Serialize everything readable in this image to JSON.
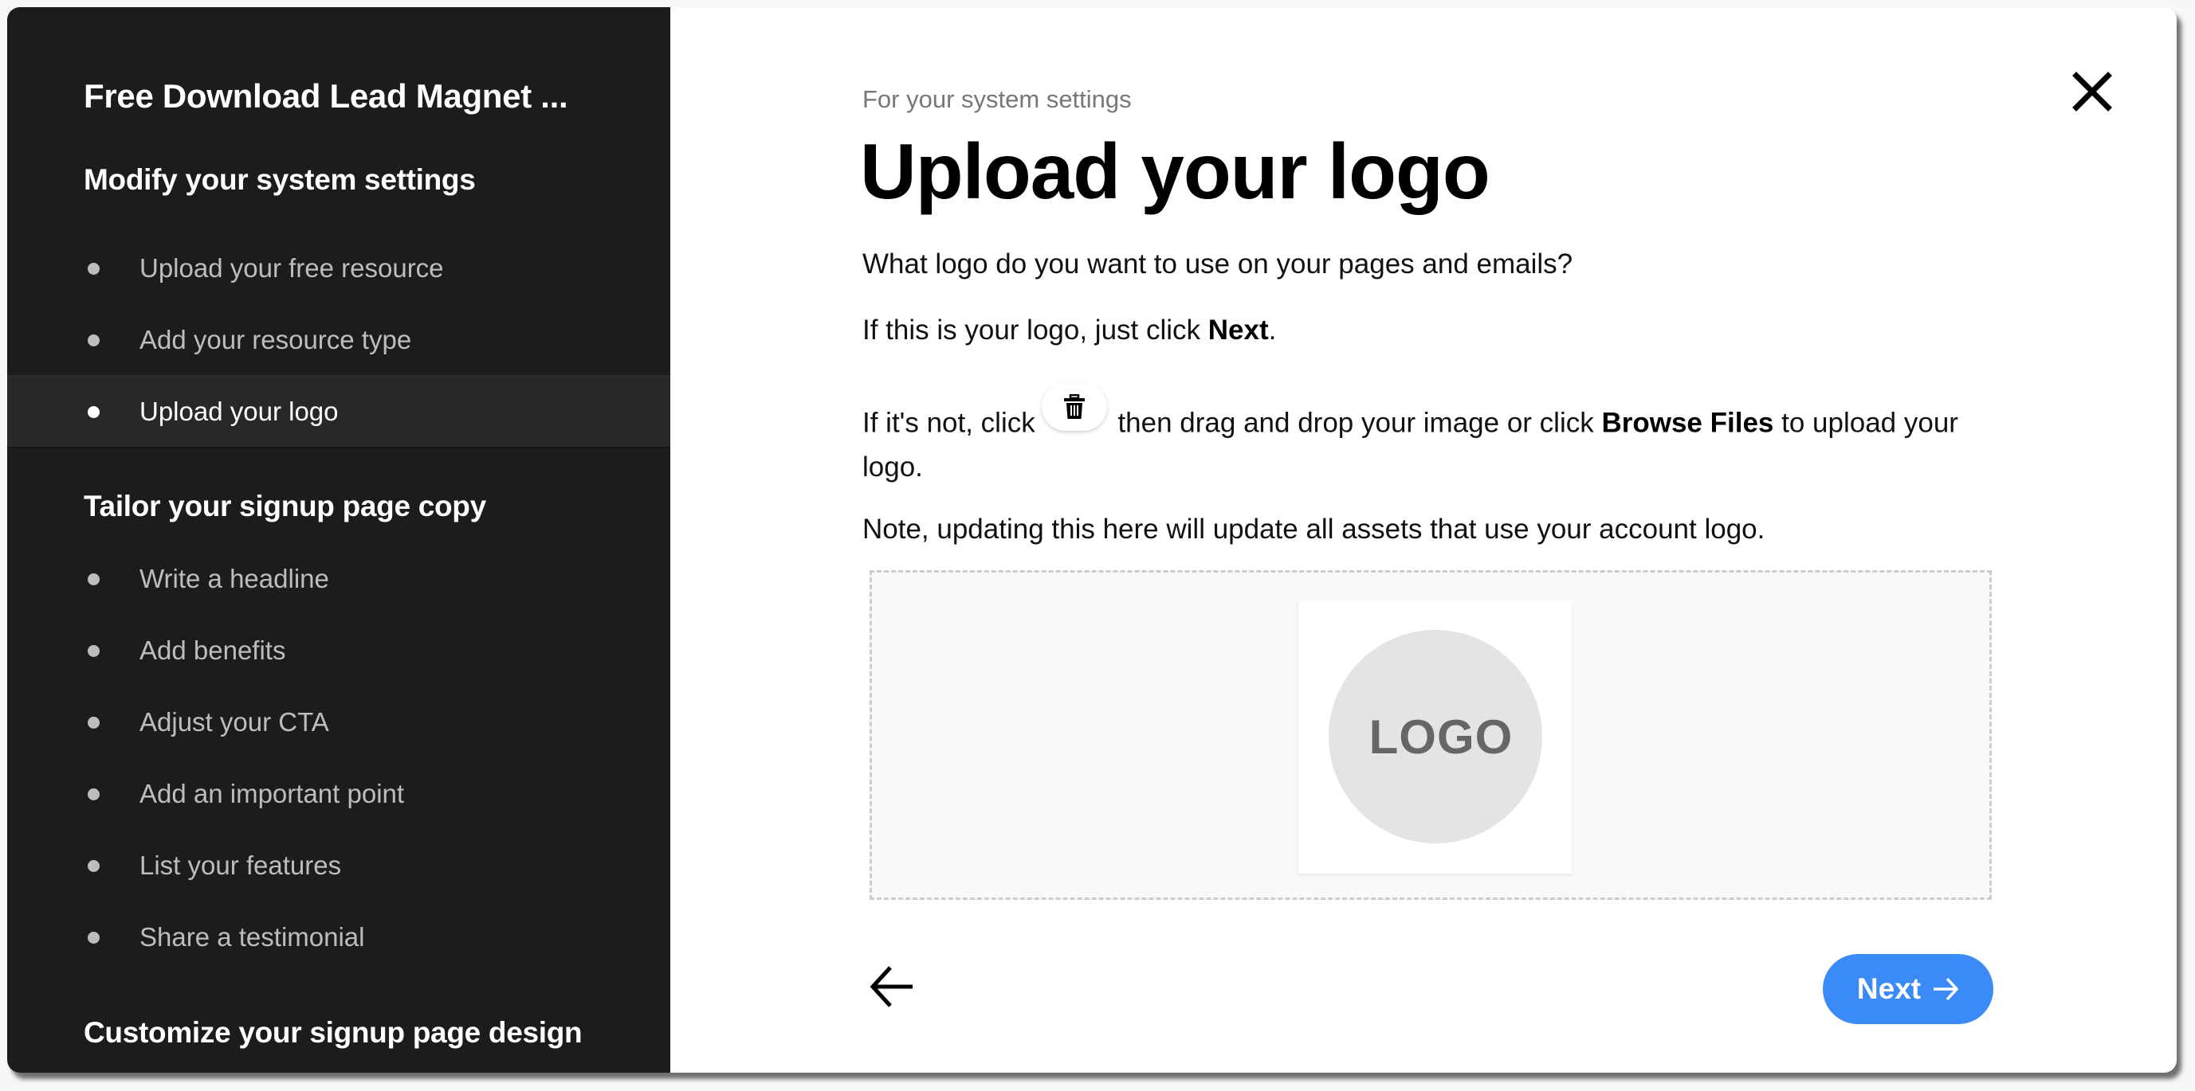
{
  "sidebar": {
    "title": "Free Download Lead Magnet ...",
    "sections": [
      {
        "heading": "Modify your system settings",
        "items": [
          {
            "label": "Upload your free resource",
            "active": false
          },
          {
            "label": "Add your resource type",
            "active": false
          },
          {
            "label": "Upload your logo",
            "active": true
          }
        ]
      },
      {
        "heading": "Tailor your signup page copy",
        "items": [
          {
            "label": "Write a headline",
            "active": false
          },
          {
            "label": "Add benefits",
            "active": false
          },
          {
            "label": "Adjust your CTA",
            "active": false
          },
          {
            "label": "Add an important point",
            "active": false
          },
          {
            "label": "List your features",
            "active": false
          },
          {
            "label": "Share a testimonial",
            "active": false
          }
        ]
      },
      {
        "heading": "Customize your signup page design",
        "items": []
      }
    ]
  },
  "main": {
    "eyebrow": "For your system settings",
    "title": "Upload your logo",
    "question": "What logo do you want to use on your pages and emails?",
    "if_logo_prefix": "If this is your logo, just click ",
    "if_logo_bold": "Next",
    "if_logo_suffix": ".",
    "if_not_prefix": "If it's not, click",
    "if_not_middle": " then drag and drop your image or click ",
    "if_not_bold": "Browse Files",
    "if_not_suffix": " to upload your logo.",
    "note": "Note, updating this here will update all assets that use your account logo.",
    "logo_placeholder_text": "LOGO",
    "icons": {
      "close": "close-icon",
      "trash": "trash-icon",
      "back": "arrow-left-icon",
      "next": "arrow-right-icon"
    }
  },
  "footer": {
    "next_label": "Next"
  },
  "colors": {
    "sidebar_bg": "#1c1c1c",
    "sidebar_active_bg": "#282828",
    "accent": "#3a8af7",
    "dropzone_border": "#cccccc"
  }
}
